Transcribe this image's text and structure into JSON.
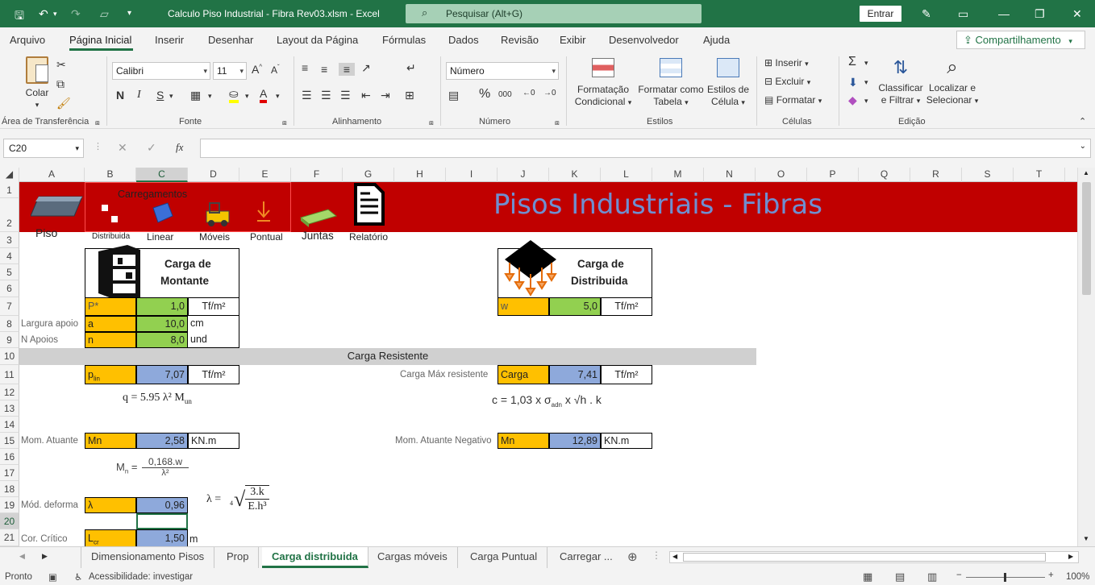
{
  "window": {
    "title": "Calculo Piso Industrial - Fibra Rev03.xlsm  -  Excel",
    "search_placeholder": "Pesquisar (Alt+G)",
    "signin": "Entrar"
  },
  "menu": {
    "tabs": [
      "Arquivo",
      "Página Inicial",
      "Inserir",
      "Desenhar",
      "Layout da Página",
      "Fórmulas",
      "Dados",
      "Revisão",
      "Exibir",
      "Desenvolvedor",
      "Ajuda"
    ],
    "active": "Página Inicial",
    "share": "Compartilhamento"
  },
  "ribbon": {
    "clipboard": {
      "paste": "Colar",
      "group": "Área de Transferência"
    },
    "font": {
      "name": "Calibri",
      "size": "11",
      "bold": "N",
      "italic": "I",
      "underline": "S",
      "group": "Fonte"
    },
    "alignment": {
      "group": "Alinhamento"
    },
    "number": {
      "format": "Número",
      "percent": "%",
      "thousands": "000",
      "group": "Número"
    },
    "styles": {
      "cond_format_1": "Formatação",
      "cond_format_2": "Condicional",
      "as_table_1": "Formatar como",
      "as_table_2": "Tabela",
      "cell_styles_1": "Estilos de",
      "cell_styles_2": "Célula",
      "group": "Estilos"
    },
    "cells": {
      "insert": "Inserir",
      "delete": "Excluir",
      "format": "Formatar",
      "group": "Células"
    },
    "editing": {
      "sort_1": "Classificar",
      "sort_2": "e Filtrar",
      "find_1": "Localizar e",
      "find_2": "Selecionar",
      "group": "Edição"
    }
  },
  "formula_bar": {
    "namebox": "C20",
    "fx": "fx",
    "formula": ""
  },
  "columns": [
    "A",
    "B",
    "C",
    "D",
    "E",
    "F",
    "G",
    "H",
    "I",
    "J",
    "K",
    "L",
    "M",
    "N",
    "O",
    "P",
    "Q",
    "R",
    "S",
    "T"
  ],
  "selected_column": "C",
  "rows": [
    "1",
    "2",
    "3",
    "4",
    "5",
    "6",
    "7",
    "8",
    "9",
    "10",
    "11",
    "12",
    "13",
    "14",
    "15",
    "16",
    "17",
    "18",
    "19",
    "20",
    "21"
  ],
  "selected_row": "20",
  "banner": {
    "title": "Pisos Industriais - Fibras",
    "group_label": "Carregamentos",
    "icons": [
      "Piso",
      "Distribuida",
      "Linear",
      "Móveis",
      "Pontual",
      "Juntas",
      "Relatório"
    ]
  },
  "montante": {
    "title_1": "Carga de",
    "title_2": "Montante",
    "rows": [
      {
        "label": "",
        "sym": "P*",
        "value": "1,0",
        "unit": "Tf/m²"
      },
      {
        "label": "Largura apoio",
        "sym": "a",
        "value": "10,0",
        "unit": "cm"
      },
      {
        "label": "N Apoios",
        "sym": "n",
        "value": "8,0",
        "unit": "und"
      }
    ]
  },
  "distribuida": {
    "title_1": "Carga de",
    "title_2": "Distribuida",
    "sym": "w",
    "value": "5,0",
    "unit": "Tf/m²"
  },
  "resistente": {
    "header": "Carga Resistente",
    "plin": {
      "sym": "p",
      "sub": "lin",
      "value": "7,07",
      "unit": "Tf/m²"
    },
    "formula_q": "q = 5.95 λ² M",
    "formula_q_sub": "un",
    "carga_max": {
      "label": "Carga Máx resistente",
      "sym": "Carga",
      "value": "7,41",
      "unit": "Tf/m²"
    },
    "formula_c": "c = 1,03 x σ",
    "formula_c_sub": "adn",
    "formula_c_rest": "x √h . k"
  },
  "momento": {
    "label": "Mom. Atuante",
    "sym": "Mn",
    "value": "2,58",
    "unit": "KN.m",
    "neg_label": "Mom. Atuante Negativo",
    "neg_sym": "Mn",
    "neg_value": "12,89",
    "neg_unit": "KN.m",
    "formula_m": "M",
    "formula_m_sub": "n",
    "formula_m_num": "0,168.w",
    "formula_m_den": "λ²"
  },
  "deform": {
    "label": "Mód. deforma",
    "sym": "λ",
    "value": "0,96",
    "formula_lambda": "λ =",
    "formula_root": "4",
    "formula_num": "3.k",
    "formula_den": "E.h³"
  },
  "critico": {
    "label": "Cor. Crítico",
    "sym": "L",
    "sub": "cr",
    "value": "1,50",
    "unit": "m"
  },
  "sheets": [
    "Dimensionamento Pisos",
    "Prop",
    "Carga distribuida",
    "Cargas móveis",
    "Carga Puntual",
    "Carregar ..."
  ],
  "active_sheet": "Carga distribuida",
  "status": {
    "ready": "Pronto",
    "accessibility": "Acessibilidade: investigar",
    "zoom": "100%"
  },
  "colors": {
    "excel_green": "#217346",
    "banner_red": "#c00000",
    "orange": "#ffc000",
    "green": "#92d050",
    "blue": "#8ea9db"
  }
}
